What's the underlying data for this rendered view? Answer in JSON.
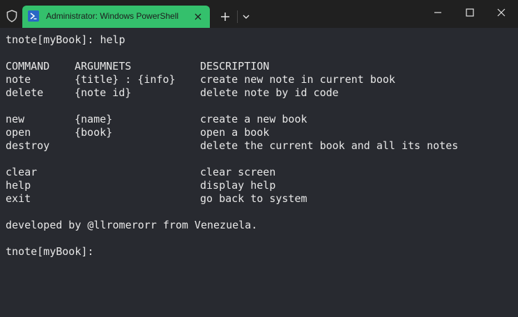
{
  "window": {
    "tab_title": "Administrator: Windows PowerShell",
    "icons": {
      "shield": "shield-icon",
      "tab": "powershell-icon",
      "tab_close": "close-icon",
      "new_tab": "plus-icon",
      "dropdown": "chevron-down-icon",
      "minimize": "minimize-icon",
      "maximize": "maximize-icon",
      "close": "close-icon"
    },
    "colors": {
      "tab_background": "#34c06c",
      "titlebar_background": "#202020",
      "terminal_background": "#282a30",
      "terminal_text": "#e8e8e8"
    }
  },
  "terminal": {
    "prompt_command": "tnote[myBook]: help",
    "headers": [
      "COMMAND",
      "ARGUMNETS",
      "DESCRIPTION"
    ],
    "groups": [
      [
        {
          "command": "note",
          "args": "{title} : {info}",
          "description": "create new note in current book"
        },
        {
          "command": "delete",
          "args": "{note id}",
          "description": "delete note by id code"
        }
      ],
      [
        {
          "command": "new",
          "args": "{name}",
          "description": "create a new book"
        },
        {
          "command": "open",
          "args": "{book}",
          "description": "open a book"
        },
        {
          "command": "destroy",
          "args": "",
          "description": "delete the current book and all its notes"
        }
      ],
      [
        {
          "command": "clear",
          "args": "",
          "description": "clear screen"
        },
        {
          "command": "help",
          "args": "",
          "description": "display help"
        },
        {
          "command": "exit",
          "args": "",
          "description": "go back to system"
        }
      ]
    ],
    "credits": "developed by @llromerorr from Venezuela.",
    "prompt": "tnote[myBook]:"
  }
}
